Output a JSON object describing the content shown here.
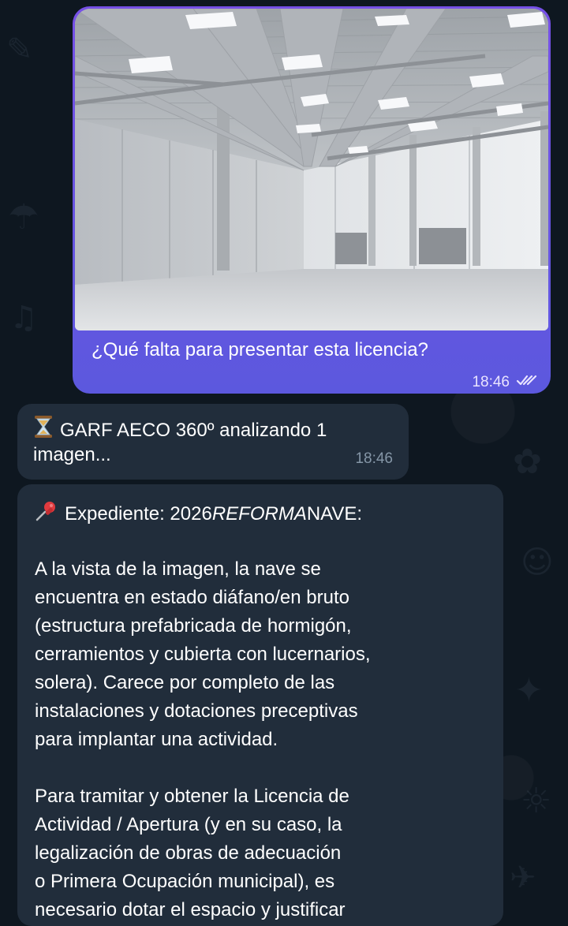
{
  "outgoing": {
    "caption": "¿Qué falta para presentar esta licencia?",
    "time": "18:46",
    "status": "read",
    "status_icon": "double-check-icon"
  },
  "incoming_status": {
    "icon": "hourglass-icon",
    "line1": "GARF AECO 360º analizando 1",
    "line2": "imagen...",
    "time": "18:46"
  },
  "incoming_reply": {
    "pin_icon": "pushpin-icon",
    "header_label": "Expediente: 2026",
    "header_italic": "REFORMA",
    "header_suffix": "NAVE:",
    "paragraph1": [
      "A la vista de la imagen, la nave se",
      "encuentra en estado diáfano/en bruto",
      "(estructura prefabricada de hormigón,",
      "cerramientos y cubierta con lucernarios,",
      "solera). Carece por completo de las",
      "instalaciones y dotaciones preceptivas",
      "para implantar una actividad."
    ],
    "paragraph2": [
      "Para tramitar y obtener la Licencia de",
      "Actividad / Apertura (y en su caso, la",
      "legalización de obras de adecuación",
      "o Primera Ocupación municipal), es",
      "necesario dotar el espacio y justificar"
    ]
  },
  "colors": {
    "background": "#0e1720",
    "outgoing_bubble": "#6b4fe0",
    "incoming_bubble": "#212d3b",
    "meta_text": "#8596a7"
  }
}
